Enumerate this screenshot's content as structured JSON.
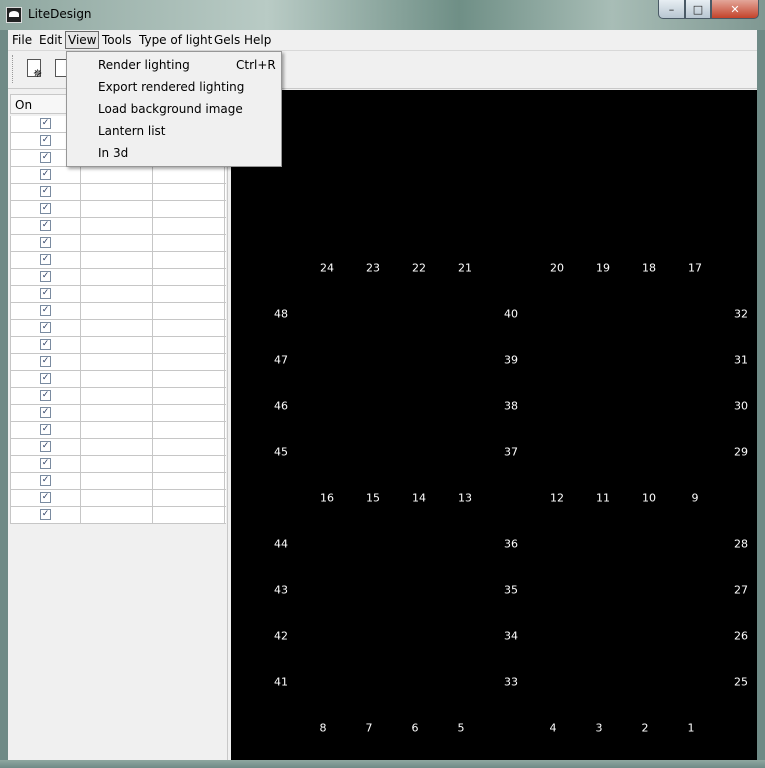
{
  "window": {
    "title": "LiteDesign"
  },
  "menubar": [
    "File",
    "Edit",
    "View",
    "Tools",
    "Type of light",
    "Gels",
    "Help"
  ],
  "view_menu": {
    "items": [
      {
        "label": "Render lighting",
        "shortcut": "Ctrl+R"
      },
      {
        "label": "Export rendered lighting",
        "shortcut": ""
      },
      {
        "label": "Load background image",
        "shortcut": ""
      },
      {
        "label": "Lantern list",
        "shortcut": ""
      },
      {
        "label": "In 3d",
        "shortcut": ""
      }
    ]
  },
  "lantern_table": {
    "header": "On",
    "row_count": 24,
    "check_glyph": "✓"
  },
  "canvas": {
    "background": "#000000",
    "lanterns": [
      "24",
      "23",
      "22",
      "21",
      "20",
      "19",
      "18",
      "17",
      "48",
      "40",
      "32",
      "47",
      "39",
      "31",
      "46",
      "38",
      "30",
      "45",
      "37",
      "29",
      "16",
      "15",
      "14",
      "13",
      "12",
      "11",
      "10",
      "9",
      "44",
      "36",
      "28",
      "43",
      "35",
      "27",
      "42",
      "34",
      "26",
      "41",
      "33",
      "25",
      "8",
      "7",
      "6",
      "5",
      "4",
      "3",
      "2",
      "1"
    ]
  }
}
